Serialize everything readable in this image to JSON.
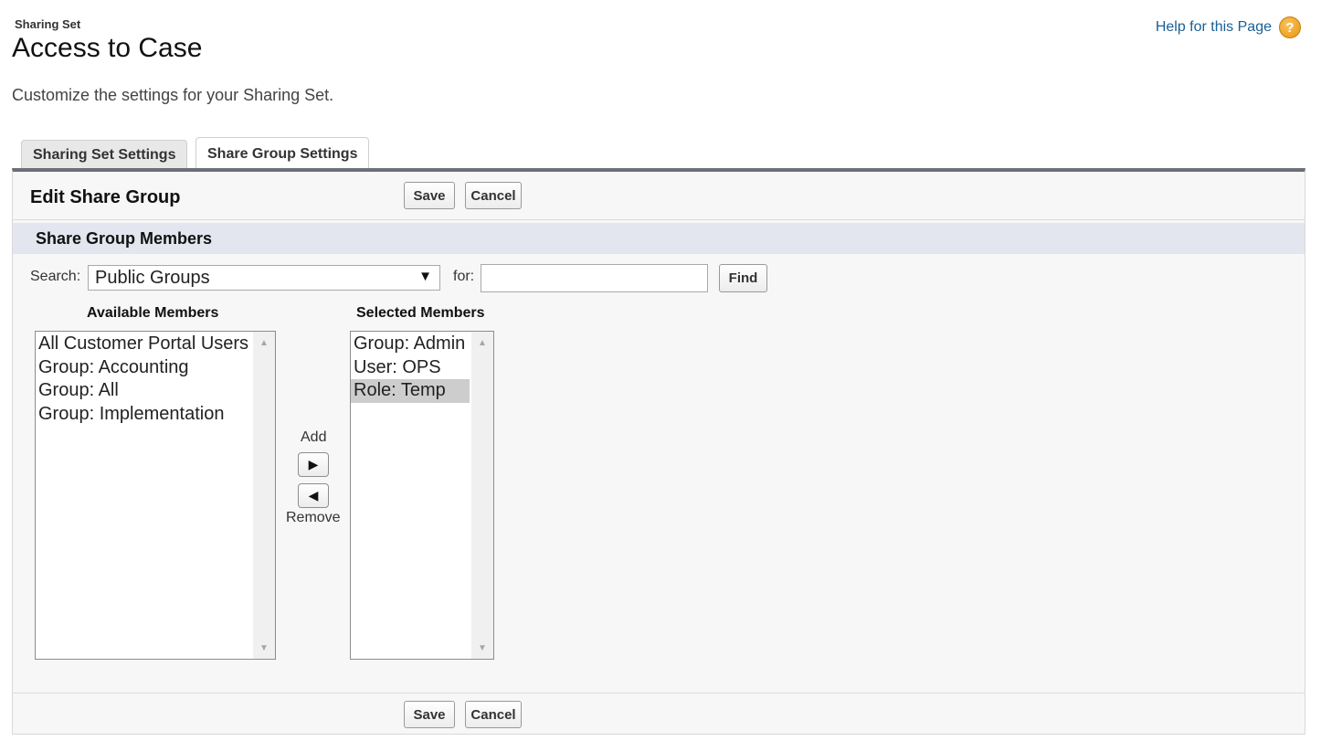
{
  "header": {
    "breadcrumb": "Sharing Set",
    "title": "Access to Case",
    "help_link": "Help for this Page",
    "help_icon": "question-circle-icon",
    "help_icon_glyph": "?",
    "description": "Customize the settings for your Sharing Set."
  },
  "tabs": [
    {
      "label": "Sharing Set Settings",
      "active": false
    },
    {
      "label": "Share Group Settings",
      "active": true
    }
  ],
  "panel": {
    "title": "Edit Share Group",
    "save_label": "Save",
    "cancel_label": "Cancel",
    "section_title": "Share Group Members"
  },
  "search": {
    "label": "Search:",
    "selected_option": "Public Groups",
    "for_label": "for:",
    "for_value": "",
    "find_label": "Find"
  },
  "available": {
    "title": "Available Members",
    "items": [
      "All Customer Portal Users",
      "Group: Accounting",
      "Group: All",
      "Group: Implementation"
    ]
  },
  "selected": {
    "title": "Selected Members",
    "items": [
      "Group: Admin",
      "User: OPS",
      "Role: Temp"
    ],
    "highlighted_index": 2
  },
  "mover": {
    "add_label": "Add",
    "remove_label": "Remove"
  },
  "colors": {
    "panel_top_border": "#6b6f78",
    "section_bg": "#e3e6ee",
    "link": "#1a5f96",
    "help_icon": "#e8960f"
  }
}
